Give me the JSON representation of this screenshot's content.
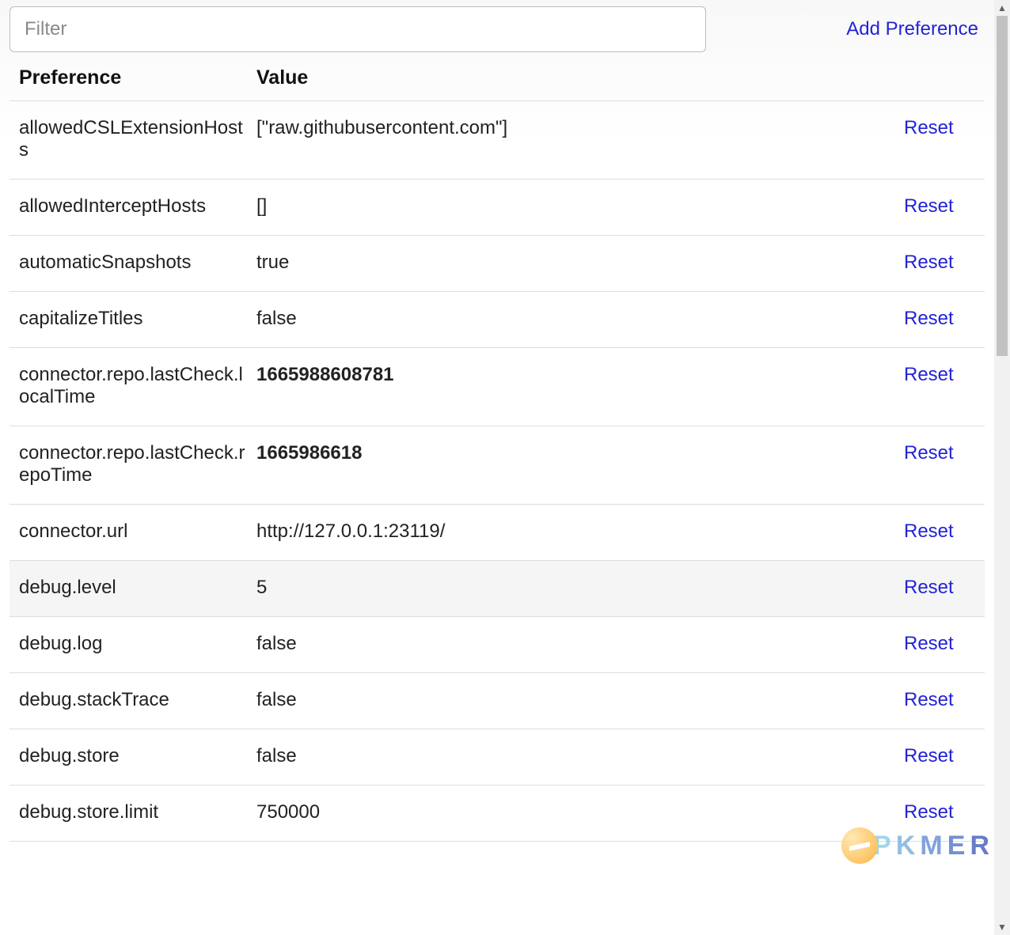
{
  "filter": {
    "placeholder": "Filter",
    "value": ""
  },
  "buttons": {
    "add_preference": "Add Preference",
    "reset": "Reset"
  },
  "columns": {
    "preference": "Preference",
    "value": "Value"
  },
  "rows": [
    {
      "pref": "allowedCSLExtensionHosts",
      "value": "[\"raw.githubusercontent.com\"]",
      "bold": false,
      "highlight": false
    },
    {
      "pref": "allowedInterceptHosts",
      "value": "[]",
      "bold": false,
      "highlight": false
    },
    {
      "pref": "automaticSnapshots",
      "value": "true",
      "bold": false,
      "highlight": false
    },
    {
      "pref": "capitalizeTitles",
      "value": "false",
      "bold": false,
      "highlight": false
    },
    {
      "pref": "connector.repo.lastCheck.localTime",
      "value": "1665988608781",
      "bold": true,
      "highlight": false
    },
    {
      "pref": "connector.repo.lastCheck.repoTime",
      "value": "1665986618",
      "bold": true,
      "highlight": false
    },
    {
      "pref": "connector.url",
      "value": "http://127.0.0.1:23119/",
      "bold": false,
      "highlight": false
    },
    {
      "pref": "debug.level",
      "value": "5",
      "bold": false,
      "highlight": true
    },
    {
      "pref": "debug.log",
      "value": "false",
      "bold": false,
      "highlight": false
    },
    {
      "pref": "debug.stackTrace",
      "value": "false",
      "bold": false,
      "highlight": false
    },
    {
      "pref": "debug.store",
      "value": "false",
      "bold": false,
      "highlight": false
    },
    {
      "pref": "debug.store.limit",
      "value": "750000",
      "bold": false,
      "highlight": false
    }
  ],
  "watermark": {
    "letters": [
      "P",
      "K",
      "M",
      "E",
      "R"
    ]
  }
}
